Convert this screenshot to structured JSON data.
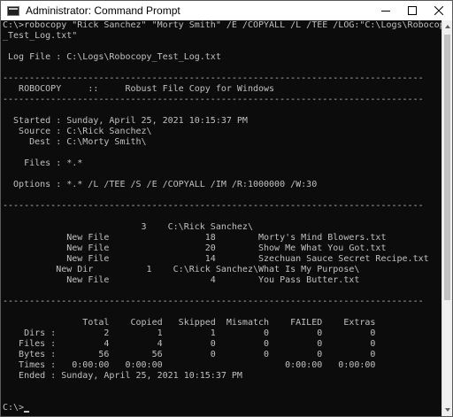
{
  "window": {
    "title": "Administrator: Command Prompt",
    "icon": "cmd-icon",
    "controls": [
      "minimize-icon",
      "maximize-icon",
      "close-icon"
    ]
  },
  "console": {
    "lines": [
      "C:\\>robocopy \"Rick Sanchez\" \"Morty Smith\" /E /COPYALL /L /TEE /LOG:\"C:\\Logs\\Robocopy",
      "_Test_Log.txt\"",
      "",
      " Log File : C:\\Logs\\Robocopy_Test_Log.txt",
      "",
      "-------------------------------------------------------------------------------",
      "   ROBOCOPY     ::     Robust File Copy for Windows",
      "-------------------------------------------------------------------------------",
      "",
      "  Started : Sunday, April 25, 2021 10:15:37 PM",
      "   Source : C:\\Rick Sanchez\\",
      "     Dest : C:\\Morty Smith\\",
      "",
      "    Files : *.*",
      "",
      "  Options : *.* /L /TEE /S /E /COPYALL /IM /R:1000000 /W:30",
      "",
      "-------------------------------------------------------------------------------",
      "",
      "                          3    C:\\Rick Sanchez\\",
      "            New File                  18        Morty's Mind Blowers.txt",
      "            New File                  20        Show Me What You Got.txt",
      "            New File                  14        Szechuan Sauce Secret Recipe.txt",
      "          New Dir          1    C:\\Rick Sanchez\\What Is My Purpose\\",
      "            New File                   4        You Pass Butter.txt",
      "",
      "-------------------------------------------------------------------------------",
      "",
      "               Total    Copied   Skipped  Mismatch    FAILED    Extras",
      "    Dirs :         2         1         1         0         0         0",
      "   Files :         4         4         0         0         0         0",
      "   Bytes :        56        56         0         0         0         0",
      "   Times :   0:00:00   0:00:00                       0:00:00   0:00:00",
      "   Ended : Sunday, April 25, 2021 10:15:37 PM",
      "",
      "",
      "C:\\>"
    ],
    "prompt_line_index": 36
  },
  "colors": {
    "background": "#0c0c0c",
    "text": "#c0c0c0",
    "titlebar": "#ffffff"
  }
}
